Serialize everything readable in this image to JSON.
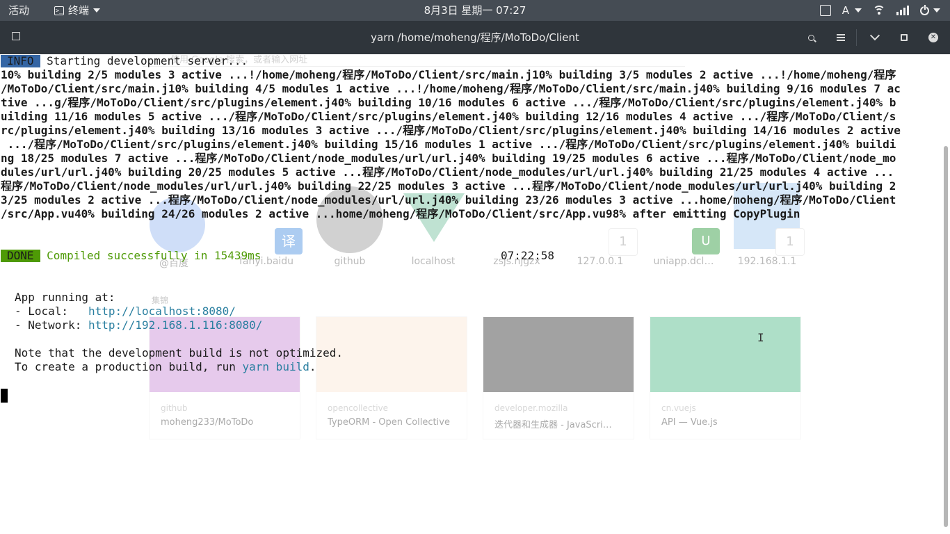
{
  "topbar": {
    "activities": "活动",
    "app_name": "终端",
    "clock": "8月3日 星期一  07:27",
    "input_method": "A"
  },
  "window": {
    "title": "yarn /home/moheng/程序/MoToDo/Client"
  },
  "browser_ghost": {
    "url_placeholder": "使用 Google 搜索，或者输入网址",
    "tiles": [
      {
        "label": "@百度"
      },
      {
        "label": "fanyi.baidu"
      },
      {
        "label": "github"
      },
      {
        "label": "localhost"
      },
      {
        "label": "zsjs.njgzx"
      },
      {
        "label": "127.0.0.1",
        "badge": "1"
      },
      {
        "label": "uniapp.dcl…"
      },
      {
        "label": "192.168.1.1",
        "badge": "1"
      }
    ],
    "fanyi_badge": "译",
    "uni_badge": "U",
    "collection_label": "集锦",
    "cards": [
      {
        "source": "github",
        "title": "moheng233/MoToDo"
      },
      {
        "source": "opencollective",
        "title": "TypeORM - Open Collective"
      },
      {
        "source": "developer.mozilla",
        "title": "迭代器和生成器 - JavaScri…"
      },
      {
        "source": "cn.vuejs",
        "title": "API — Vue.js"
      }
    ]
  },
  "terminal": {
    "info_tag": "INFO",
    "info_text": "Starting development server...",
    "build_log": [
      "10% building 2/5 modules 3 active ...!/home/moheng/程序/MoToDo/Client/src/main.j10% building 3/5 modules 2 active ...!/home/moheng/程序",
      "/MoToDo/Client/src/main.j10% building 4/5 modules 1 active ...!/home/moheng/程序/MoToDo/Client/src/main.j40% building 9/16 modules 7 ac",
      "tive ...g/程序/MoToDo/Client/src/plugins/element.j40% building 10/16 modules 6 active .../程序/MoToDo/Client/src/plugins/element.j40% b",
      "uilding 11/16 modules 5 active .../程序/MoToDo/Client/src/plugins/element.j40% building 12/16 modules 4 active .../程序/MoToDo/Client/s",
      "rc/plugins/element.j40% building 13/16 modules 3 active .../程序/MoToDo/Client/src/plugins/element.j40% building 14/16 modules 2 active",
      " .../程序/MoToDo/Client/src/plugins/element.j40% building 15/16 modules 1 active .../程序/MoToDo/Client/src/plugins/element.j40% buildi",
      "ng 18/25 modules 7 active ...程序/MoToDo/Client/node_modules/url/url.j40% building 19/25 modules 6 active ...程序/MoToDo/Client/node_mo",
      "dules/url/url.j40% building 20/25 modules 5 active ...程序/MoToDo/Client/node_modules/url/url.j40% building 21/25 modules 4 active ...",
      "程序/MoToDo/Client/node_modules/url/url.j40% building 22/25 modules 3 active ...程序/MoToDo/Client/node_modules/url/url.j40% building 2",
      "3/25 modules 2 active ...程序/MoToDo/Client/node_modules/url/url.j40% building 23/26 modules 3 active ...home/moheng/程序/MoToDo/Client",
      "/src/App.vu40% building 24/26 modules 2 active ...home/moheng/程序/MoToDo/Client/src/App.vu98% after emitting CopyPlugin"
    ],
    "done_tag": "DONE",
    "done_text": "Compiled successfully in 15439ms",
    "done_time": "07:22:58",
    "app_running": "App running at:",
    "local_label": "- Local:   ",
    "local_url": "http://localhost:8080/",
    "network_label": "- Network: ",
    "network_url": "http://192.168.1.116:8080/",
    "note1": "Note that the development build is not optimized.",
    "note2_prefix": "To create a production build, run ",
    "note2_cmd": "yarn build",
    "note2_suffix": "."
  }
}
